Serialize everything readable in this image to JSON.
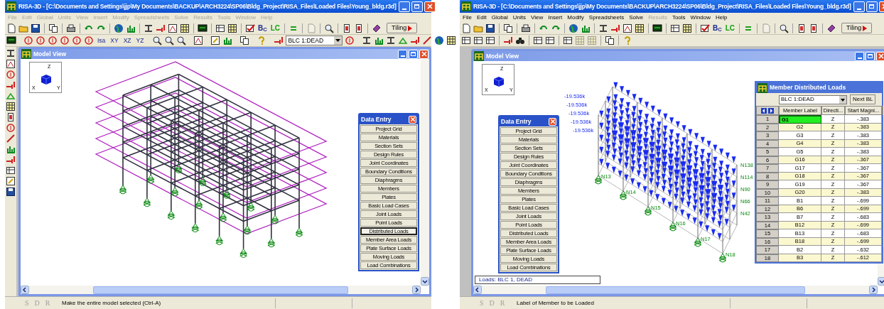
{
  "windows": [
    {
      "title": "RISA-3D - [C:\\Documents and Settings\\jjp\\My Documents\\BACKUP\\ARCH3224\\SP06\\Bldg_Project\\RISA_Files\\Loaded Files\\Young_bldg.r3d]",
      "menu": [
        {
          "label": "File",
          "disabled": true
        },
        {
          "label": "Edit",
          "disabled": true
        },
        {
          "label": "Global",
          "disabled": true
        },
        {
          "label": "Units",
          "disabled": true
        },
        {
          "label": "View",
          "disabled": true
        },
        {
          "label": "Insert",
          "disabled": true
        },
        {
          "label": "Modify",
          "disabled": true
        },
        {
          "label": "Spreadsheets",
          "disabled": true
        },
        {
          "label": "Solve",
          "disabled": true
        },
        {
          "label": "Results",
          "disabled": true
        },
        {
          "label": "Tools",
          "disabled": true
        },
        {
          "label": "Window",
          "disabled": true
        },
        {
          "label": "Help",
          "disabled": true
        }
      ],
      "toolbar_1": {
        "bc_label": "B$_{C}$",
        "lc_label": "LC",
        "tiling_button": "Tiling"
      },
      "toolbar_2": {
        "kind": "graphics",
        "view_buttons": [
          "Isa",
          "XY",
          "XZ",
          "YZ"
        ],
        "load_case": "BLC 1:DEAD"
      },
      "model_view": {
        "title": "Model View",
        "kind": "frame",
        "axis_labels": [
          "Z",
          "X",
          "Y"
        ],
        "data_entry": {
          "title": "Data Entry",
          "items": [
            {
              "label": "Project Grid",
              "selected": false
            },
            {
              "label": "Materials",
              "selected": false
            },
            {
              "label": "Section Sets",
              "selected": false
            },
            {
              "label": "Design Rules",
              "selected": false
            },
            {
              "label": "Joint Coordinates",
              "selected": false
            },
            {
              "label": "Boundary Conditions",
              "selected": false
            },
            {
              "label": "Diaphragms",
              "selected": false
            },
            {
              "label": "Members",
              "selected": false
            },
            {
              "label": "Plates",
              "selected": false
            },
            {
              "label": "Basic Load Cases",
              "selected": false
            },
            {
              "label": "Joint Loads",
              "selected": false
            },
            {
              "label": "Point Loads",
              "selected": false
            },
            {
              "label": "Distributed Loads",
              "selected": true
            },
            {
              "label": "Member Area Loads",
              "selected": false
            },
            {
              "label": "Plate Surface Loads",
              "selected": false
            },
            {
              "label": "Moving Loads",
              "selected": false
            },
            {
              "label": "Load Combinations",
              "selected": false
            }
          ]
        }
      },
      "status_bar": {
        "modes": [
          "S",
          "D",
          "R"
        ],
        "message": "Make the entire model selected (Ctrl-A)"
      }
    },
    {
      "title": "RISA-3D - [C:\\Documents and Settings\\jjp\\My Documents\\BACKUP\\ARCH3224\\SP06\\Bldg_Project\\RISA_Files\\Loaded Files\\Young_bldg.r3d]",
      "menu": [
        {
          "label": "File",
          "disabled": false
        },
        {
          "label": "Edit",
          "disabled": false
        },
        {
          "label": "Global",
          "disabled": false
        },
        {
          "label": "Units",
          "disabled": false
        },
        {
          "label": "View",
          "disabled": false
        },
        {
          "label": "Insert",
          "disabled": false
        },
        {
          "label": "Modify",
          "disabled": false
        },
        {
          "label": "Spreadsheets",
          "disabled": false
        },
        {
          "label": "Solve",
          "disabled": false
        },
        {
          "label": "Results",
          "disabled": true
        },
        {
          "label": "Tools",
          "disabled": false
        },
        {
          "label": "Window",
          "disabled": false
        },
        {
          "label": "Help",
          "disabled": false
        }
      ],
      "toolbar_1": {
        "bc_label": "B$_{C}$",
        "lc_label": "LC",
        "tiling_button": "Tiling"
      },
      "toolbar_2": {
        "kind": "spreadsheet"
      },
      "model_view": {
        "title": "Model View",
        "kind": "loads",
        "axis_labels": [
          "Z",
          "X",
          "Y"
        ],
        "load_labels": [
          "-19.536k",
          "-19.536k",
          "-19.536k",
          "-19.536k",
          "-19.536k"
        ],
        "support_labels": [
          "N13",
          "N14",
          "N15",
          "N16",
          "N17",
          "N18"
        ],
        "column_labels": [
          "N138",
          "N114",
          "N90",
          "N66",
          "N42"
        ],
        "loads_box": "Loads: BLC 1, DEAD",
        "data_entry": {
          "title": "Data Entry",
          "items": [
            {
              "label": "Project Grid",
              "selected": false
            },
            {
              "label": "Materials",
              "selected": false
            },
            {
              "label": "Section Sets",
              "selected": false
            },
            {
              "label": "Design Rules",
              "selected": false
            },
            {
              "label": "Joint Coordinates",
              "selected": false
            },
            {
              "label": "Boundary Conditions",
              "selected": false
            },
            {
              "label": "Diaphragms",
              "selected": false
            },
            {
              "label": "Members",
              "selected": false
            },
            {
              "label": "Plates",
              "selected": false
            },
            {
              "label": "Basic Load Cases",
              "selected": false
            },
            {
              "label": "Joint Loads",
              "selected": false
            },
            {
              "label": "Point Loads",
              "selected": false
            },
            {
              "label": "Distributed Loads",
              "selected": false
            },
            {
              "label": "Member Area Loads",
              "selected": false
            },
            {
              "label": "Plate Surface Loads",
              "selected": false
            },
            {
              "label": "Moving Loads",
              "selected": false
            },
            {
              "label": "Load Combinations",
              "selected": false
            }
          ]
        },
        "spreadsheet": {
          "title": "Member Distributed Loads",
          "load_case": "BLC 1:DEAD",
          "next_button": "Next BL",
          "columns": [
            "Member Label",
            "Directi...",
            "Start Magni..."
          ],
          "rows": [
            {
              "number": "1",
              "member_label": "G1",
              "direction": "Z",
              "start_magnitude": "-.383",
              "selected": true
            },
            {
              "number": "2",
              "member_label": "G2",
              "direction": "Z",
              "start_magnitude": "-.383",
              "selected": false
            },
            {
              "number": "3",
              "member_label": "G3",
              "direction": "Z",
              "start_magnitude": "-.383",
              "selected": false
            },
            {
              "number": "4",
              "member_label": "G4",
              "direction": "Z",
              "start_magnitude": "-.383",
              "selected": false
            },
            {
              "number": "5",
              "member_label": "G5",
              "direction": "Z",
              "start_magnitude": "-.383",
              "selected": false
            },
            {
              "number": "6",
              "member_label": "G16",
              "direction": "Z",
              "start_magnitude": "-.367",
              "selected": false
            },
            {
              "number": "7",
              "member_label": "G17",
              "direction": "Z",
              "start_magnitude": "-.367",
              "selected": false
            },
            {
              "number": "8",
              "member_label": "G18",
              "direction": "Z",
              "start_magnitude": "-.367",
              "selected": false
            },
            {
              "number": "9",
              "member_label": "G19",
              "direction": "Z",
              "start_magnitude": "-.367",
              "selected": false
            },
            {
              "number": "10",
              "member_label": "G20",
              "direction": "Z",
              "start_magnitude": "-.383",
              "selected": false
            },
            {
              "number": "11",
              "member_label": "B1",
              "direction": "Z",
              "start_magnitude": "-.699",
              "selected": false
            },
            {
              "number": "12",
              "member_label": "B6",
              "direction": "Z",
              "start_magnitude": "-.699",
              "selected": false
            },
            {
              "number": "13",
              "member_label": "B7",
              "direction": "Z",
              "start_magnitude": "-.683",
              "selected": false
            },
            {
              "number": "14",
              "member_label": "B12",
              "direction": "Z",
              "start_magnitude": "-.699",
              "selected": false
            },
            {
              "number": "15",
              "member_label": "B13",
              "direction": "Z",
              "start_magnitude": "-.683",
              "selected": false
            },
            {
              "number": "16",
              "member_label": "B18",
              "direction": "Z",
              "start_magnitude": "-.699",
              "selected": false
            },
            {
              "number": "17",
              "member_label": "B2",
              "direction": "Z",
              "start_magnitude": "-.632",
              "selected": false
            },
            {
              "number": "18",
              "member_label": "B3",
              "direction": "Z",
              "start_magnitude": "-.612",
              "selected": false
            }
          ]
        }
      },
      "status_bar": {
        "modes": [
          "S",
          "D",
          "R"
        ],
        "message": "Label of Member to be Loaded"
      }
    }
  ]
}
